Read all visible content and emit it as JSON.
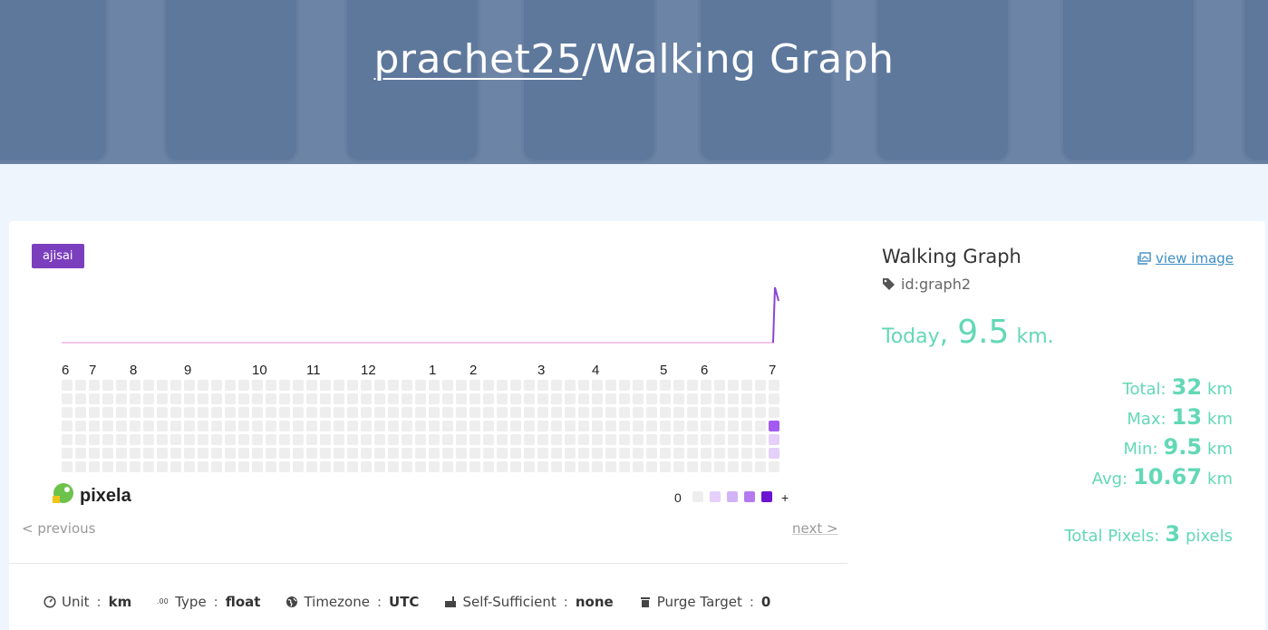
{
  "header": {
    "user": "prachet25",
    "separator": "/",
    "graph_name": "Walking Graph"
  },
  "theme_badge": "ajisai",
  "graph": {
    "month_labels": [
      "6",
      "7",
      "8",
      "9",
      "10",
      "11",
      "12",
      "1",
      "2",
      "3",
      "4",
      "5",
      "6",
      "7"
    ],
    "pixels": [
      {
        "week": 52,
        "day": 3,
        "level": 4
      },
      {
        "week": 52,
        "day": 4,
        "level": 1
      },
      {
        "week": 52,
        "day": 5,
        "level": 1
      }
    ],
    "legend": {
      "min_label": "0",
      "max_label": "+"
    },
    "colors": {
      "empty": "#eeeeee",
      "level1": "#e4d0fa",
      "level2": "#d3b3f7",
      "level3": "#b47af0",
      "level4": "#a35af0",
      "level5": "#6b13d1",
      "line": "#f3c6ec",
      "spike": "#8b44d6"
    },
    "logo_text": "pixela"
  },
  "pager": {
    "previous": "< previous",
    "next": "next >"
  },
  "meta": {
    "unit_label": "Unit",
    "unit_value": "km",
    "type_label": "Type",
    "type_value": "float",
    "timezone_label": "Timezone",
    "timezone_value": "UTC",
    "self_sufficient_label": "Self-Sufficient",
    "self_sufficient_value": "none",
    "purge_label": "Purge Target",
    "purge_value": "0",
    "sep": ":"
  },
  "panel": {
    "title": "Walking Graph",
    "view_image": "view image",
    "id": "id:graph2",
    "today_label": "Today",
    "today_comma": ",",
    "today_value": "9.5",
    "today_unit": "km.",
    "stats": {
      "total_label": "Total:",
      "total_value": "32",
      "total_unit": "km",
      "max_label": "Max:",
      "max_value": "13",
      "max_unit": "km",
      "min_label": "Min:",
      "min_value": "9.5",
      "min_unit": "km",
      "avg_label": "Avg:",
      "avg_value": "10.67",
      "avg_unit": "km",
      "pixels_label": "Total Pixels:",
      "pixels_value": "3",
      "pixels_unit": "pixels"
    }
  }
}
